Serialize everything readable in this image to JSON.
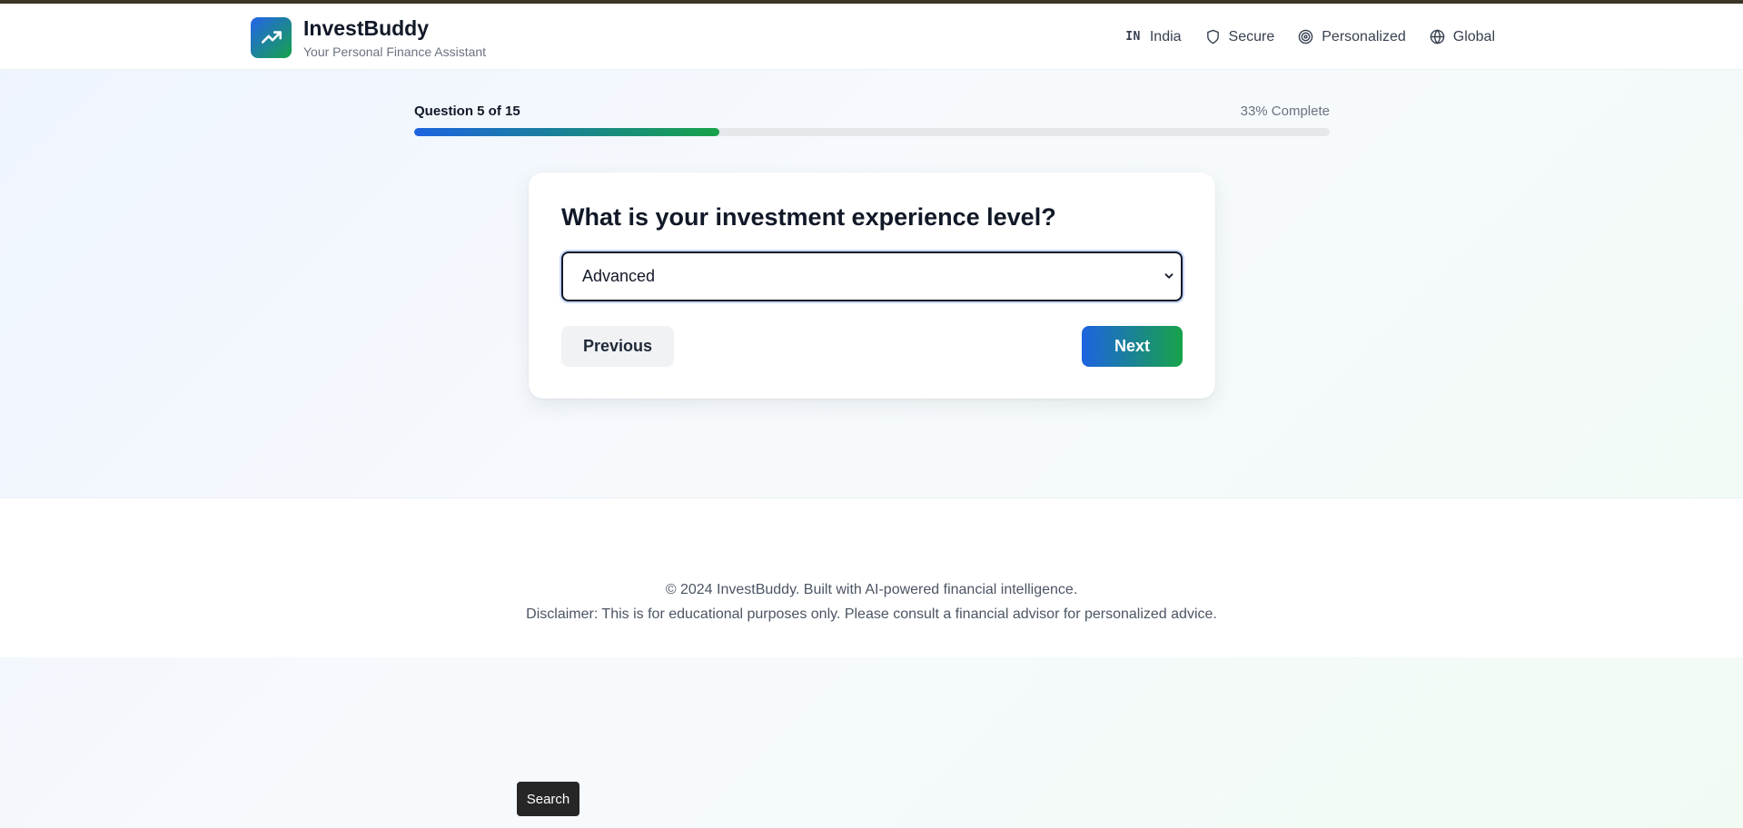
{
  "app": {
    "name": "InvestBuddy",
    "tagline": "Your Personal Finance Assistant",
    "logo_icon": "trending-up-icon"
  },
  "nav": {
    "items": [
      {
        "code": "IN",
        "label": "India",
        "icon": "flag-icon"
      },
      {
        "label": "Secure",
        "icon": "shield-icon"
      },
      {
        "label": "Personalized",
        "icon": "target-icon"
      },
      {
        "label": "Global",
        "icon": "globe-icon"
      }
    ]
  },
  "progress": {
    "question_label": "Question 5 of 15",
    "percent_label": "33% Complete",
    "fraction": 0.333
  },
  "quiz": {
    "question": "What is your investment experience level?",
    "selected_option": "Advanced",
    "previous_label": "Previous",
    "next_label": "Next"
  },
  "footer": {
    "copyright": "© 2024 InvestBuddy. Built with AI-powered financial intelligence.",
    "disclaimer": "Disclaimer: This is for educational purposes only. Please consult a financial advisor for personalized advice."
  },
  "tooltip": {
    "search_label": "Search"
  },
  "colors": {
    "brand_blue": "#1d63e0",
    "brand_green": "#17a34a",
    "text_dark": "#111827",
    "text_muted": "#6b7280"
  }
}
